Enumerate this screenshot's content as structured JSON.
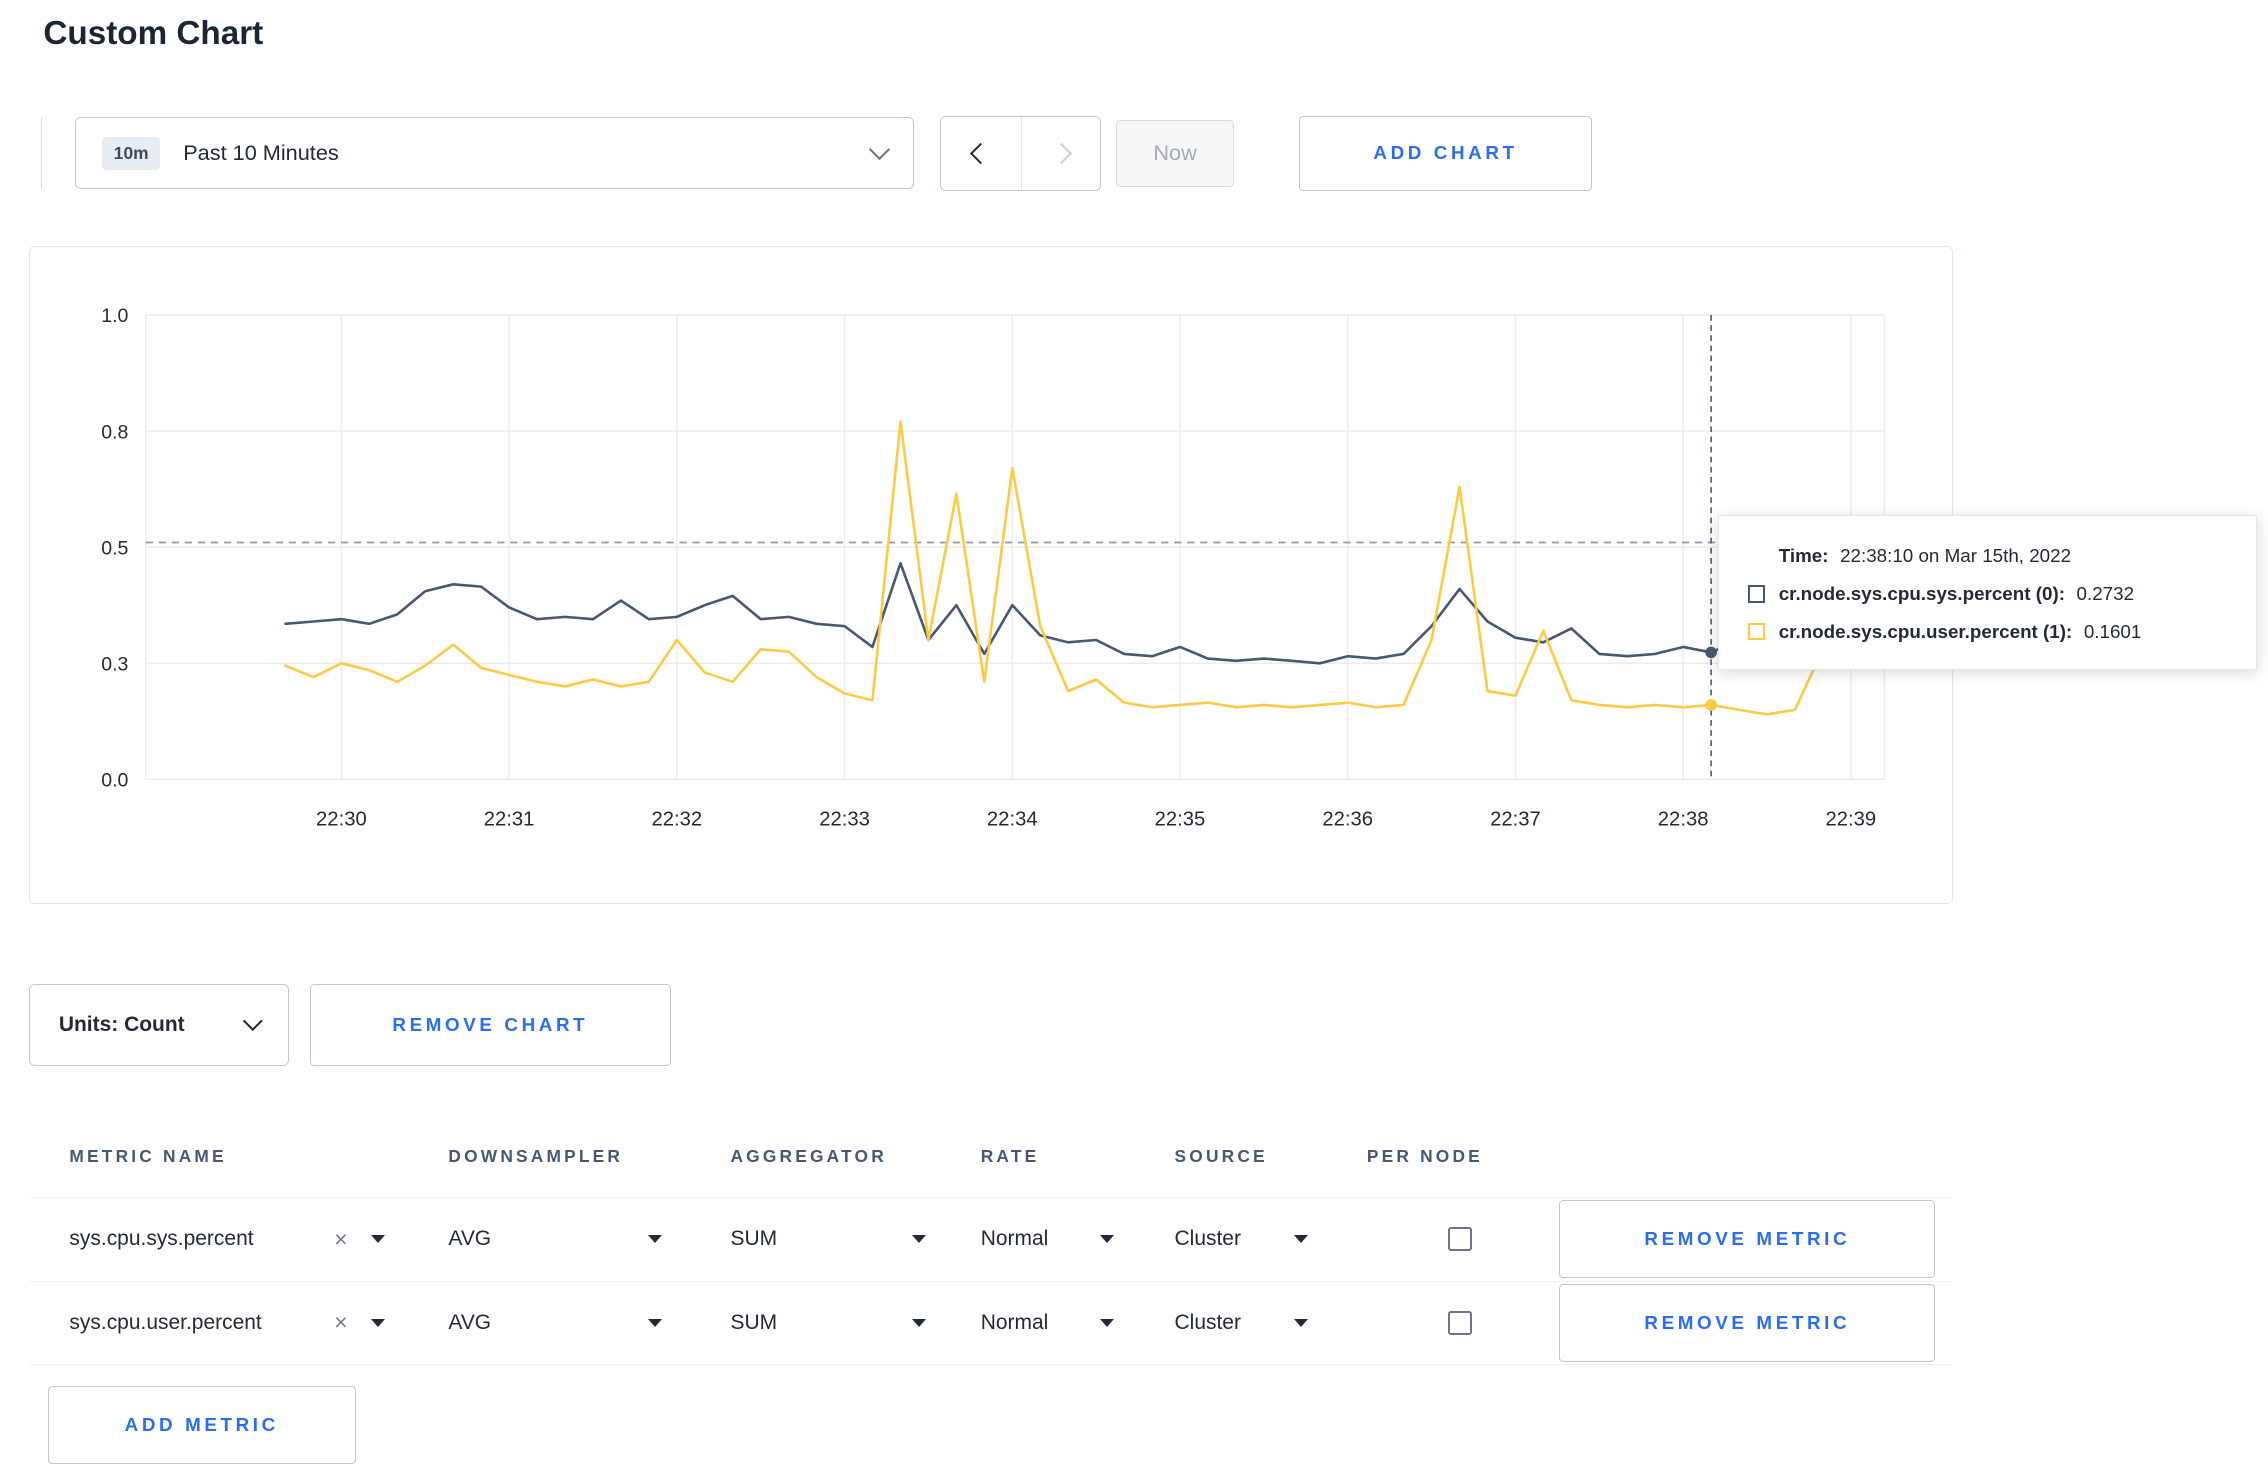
{
  "page": {
    "title": "Custom Chart"
  },
  "toolbar": {
    "range_badge": "10m",
    "range_label": "Past 10 Minutes",
    "now_label": "Now",
    "add_chart_label": "ADD CHART"
  },
  "chart_card": {
    "tooltip": {
      "time_label": "Time:",
      "time_value": "22:38:10 on Mar 15th, 2022",
      "series": [
        {
          "label": "cr.node.sys.cpu.sys.percent (0):",
          "value": "0.2732"
        },
        {
          "label": "cr.node.sys.cpu.user.percent (1):",
          "value": "0.1601"
        }
      ]
    }
  },
  "chart_controls": {
    "units_label": "Units: Count",
    "remove_chart_label": "REMOVE CHART"
  },
  "metrics_table": {
    "headers": [
      "METRIC NAME",
      "DOWNSAMPLER",
      "AGGREGATOR",
      "RATE",
      "SOURCE",
      "PER NODE"
    ],
    "rows": [
      {
        "metric": "sys.cpu.sys.percent",
        "downsampler": "AVG",
        "aggregator": "SUM",
        "rate": "Normal",
        "source": "Cluster",
        "per_node_checked": false,
        "remove_label": "REMOVE METRIC"
      },
      {
        "metric": "sys.cpu.user.percent",
        "downsampler": "AVG",
        "aggregator": "SUM",
        "rate": "Normal",
        "source": "Cluster",
        "per_node_checked": false,
        "remove_label": "REMOVE METRIC"
      }
    ],
    "add_metric_label": "ADD METRIC"
  },
  "icons": {
    "close": "×"
  },
  "chart_data": {
    "type": "line",
    "title": "",
    "xlabel": "time",
    "ylabel": "",
    "x_unit": "seconds offset from 22:29:30",
    "xlim": [
      -40,
      582
    ],
    "ylim": [
      0,
      1
    ],
    "grid": true,
    "x": [
      10,
      20,
      30,
      40,
      50,
      60,
      70,
      80,
      90,
      100,
      110,
      120,
      130,
      140,
      150,
      160,
      170,
      180,
      190,
      200,
      210,
      220,
      230,
      240,
      250,
      260,
      270,
      280,
      290,
      300,
      310,
      320,
      330,
      340,
      350,
      360,
      370,
      380,
      390,
      400,
      410,
      420,
      430,
      440,
      450,
      460,
      470,
      480,
      490,
      500,
      510,
      520,
      530,
      540,
      550,
      560,
      570
    ],
    "series": [
      {
        "name": "cr.node.sys.cpu.sys.percent",
        "color": "#475872",
        "values": [
          0.335,
          0.34,
          0.345,
          0.335,
          0.355,
          0.405,
          0.42,
          0.415,
          0.37,
          0.345,
          0.35,
          0.345,
          0.385,
          0.345,
          0.35,
          0.375,
          0.395,
          0.345,
          0.35,
          0.335,
          0.33,
          0.285,
          0.465,
          0.3,
          0.375,
          0.27,
          0.375,
          0.31,
          0.295,
          0.3,
          0.27,
          0.265,
          0.285,
          0.26,
          0.255,
          0.26,
          0.255,
          0.25,
          0.265,
          0.26,
          0.27,
          0.33,
          0.41,
          0.34,
          0.305,
          0.295,
          0.325,
          0.27,
          0.265,
          0.27,
          0.285,
          0.2732,
          0.3,
          0.305,
          0.3,
          0.305,
          0.31
        ]
      },
      {
        "name": "cr.node.sys.cpu.user.percent",
        "color": "#fdca44",
        "values": [
          0.245,
          0.22,
          0.25,
          0.235,
          0.21,
          0.245,
          0.29,
          0.24,
          0.225,
          0.21,
          0.2,
          0.215,
          0.2,
          0.21,
          0.3,
          0.23,
          0.21,
          0.28,
          0.275,
          0.22,
          0.185,
          0.17,
          0.77,
          0.3,
          0.615,
          0.21,
          0.67,
          0.33,
          0.19,
          0.215,
          0.165,
          0.155,
          0.16,
          0.165,
          0.155,
          0.16,
          0.155,
          0.16,
          0.165,
          0.155,
          0.16,
          0.3,
          0.63,
          0.19,
          0.18,
          0.32,
          0.17,
          0.16,
          0.155,
          0.16,
          0.155,
          0.1601,
          0.15,
          0.14,
          0.15,
          0.28,
          0.245
        ]
      }
    ],
    "x_ticks": [
      {
        "t": 30,
        "label": "22:30"
      },
      {
        "t": 90,
        "label": "22:31"
      },
      {
        "t": 150,
        "label": "22:32"
      },
      {
        "t": 210,
        "label": "22:33"
      },
      {
        "t": 270,
        "label": "22:34"
      },
      {
        "t": 330,
        "label": "22:35"
      },
      {
        "t": 390,
        "label": "22:36"
      },
      {
        "t": 450,
        "label": "22:37"
      },
      {
        "t": 510,
        "label": "22:38"
      },
      {
        "t": 570,
        "label": "22:39"
      }
    ],
    "y_ticks": [
      {
        "v": 0,
        "label": "0.0"
      },
      {
        "v": 0.25,
        "label": "0.3"
      },
      {
        "v": 0.5,
        "label": "0.5"
      },
      {
        "v": 0.75,
        "label": "0.8"
      },
      {
        "v": 1,
        "label": "1.0"
      }
    ],
    "hline": 0.51,
    "crosshair_t": 520,
    "markers": [
      {
        "series": 0,
        "t": 520,
        "v": 0.2732
      },
      {
        "series": 1,
        "t": 520,
        "v": 0.1601
      }
    ]
  }
}
